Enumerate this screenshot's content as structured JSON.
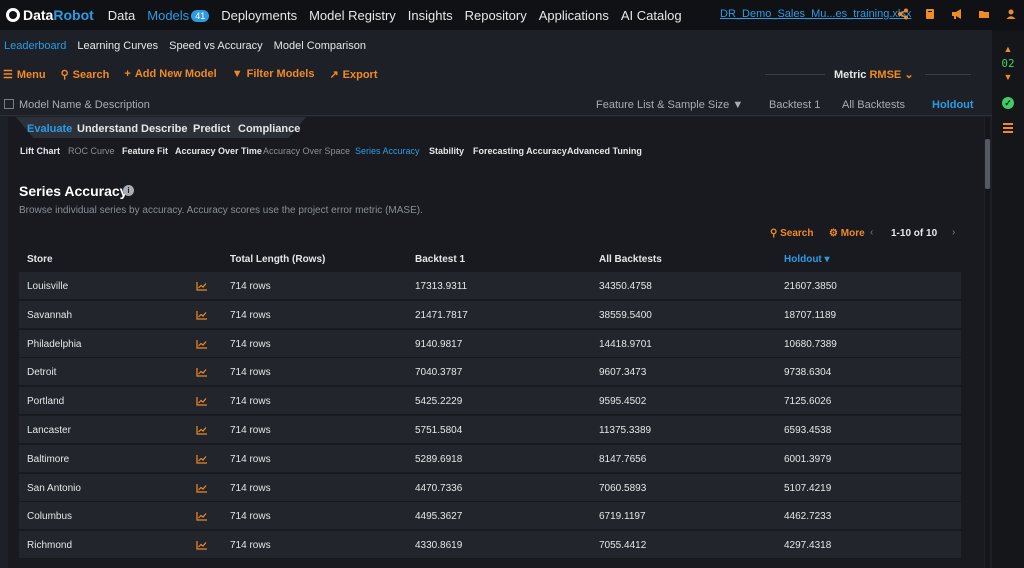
{
  "brand": {
    "part1": "Data",
    "part2": "Robot"
  },
  "nav": {
    "items": [
      {
        "label": "Data"
      },
      {
        "label": "Models",
        "badge": "41",
        "active": true
      },
      {
        "label": "Deployments"
      },
      {
        "label": "Model Registry"
      },
      {
        "label": "Insights"
      },
      {
        "label": "Repository"
      },
      {
        "label": "Applications"
      },
      {
        "label": "AI Catalog"
      }
    ],
    "filename": "DR_Demo_Sales_Mu...es_training.xlsx",
    "icons": [
      "share-icon",
      "book-icon",
      "megaphone-icon",
      "folder-icon",
      "user-icon"
    ]
  },
  "subnav": [
    "Leaderboard",
    "Learning Curves",
    "Speed vs Accuracy",
    "Model Comparison"
  ],
  "toolbar": {
    "menu": "Menu",
    "search": "Search",
    "add": "Add New Model",
    "filter": "Filter Models",
    "export": "Export",
    "metric_label": "Metric",
    "metric_value": "RMSE"
  },
  "columns": {
    "name": "Model Name & Description",
    "feature_list": "Feature List & Sample Size",
    "backtest1": "Backtest 1",
    "all_backtests": "All Backtests",
    "holdout": "Holdout"
  },
  "rail": {
    "number": "02"
  },
  "eval_tabs": [
    "Evaluate",
    "Understand",
    "Describe",
    "Predict",
    "Compliance"
  ],
  "sub_tabs": [
    "Lift Chart",
    "ROC Curve",
    "Feature Fit",
    "Accuracy Over Time",
    "Accuracy Over Space",
    "Series Accuracy",
    "Stability",
    "Forecasting Accuracy",
    "Advanced Tuning"
  ],
  "series": {
    "title": "Series Accuracy",
    "description": "Browse individual series by accuracy. Accuracy scores use the project error metric (MASE).",
    "search": "Search",
    "more": "More",
    "pagination": "1-10 of 10"
  },
  "table": {
    "headers": [
      "Store",
      "Total Length (Rows)",
      "Backtest 1",
      "All Backtests",
      "Holdout"
    ],
    "rows": [
      {
        "store": "Louisville",
        "length": "714 rows",
        "backtest1": "17313.9311",
        "all": "34350.4758",
        "holdout": "21607.3850"
      },
      {
        "store": "Savannah",
        "length": "714 rows",
        "backtest1": "21471.7817",
        "all": "38559.5400",
        "holdout": "18707.1189"
      },
      {
        "store": "Philadelphia",
        "length": "714 rows",
        "backtest1": "9140.9817",
        "all": "14418.9701",
        "holdout": "10680.7389"
      },
      {
        "store": "Detroit",
        "length": "714 rows",
        "backtest1": "7040.3787",
        "all": "9607.3473",
        "holdout": "9738.6304"
      },
      {
        "store": "Portland",
        "length": "714 rows",
        "backtest1": "5425.2229",
        "all": "9595.4502",
        "holdout": "7125.6026"
      },
      {
        "store": "Lancaster",
        "length": "714 rows",
        "backtest1": "5751.5804",
        "all": "11375.3389",
        "holdout": "6593.4538"
      },
      {
        "store": "Baltimore",
        "length": "714 rows",
        "backtest1": "5289.6918",
        "all": "8147.7656",
        "holdout": "6001.3979"
      },
      {
        "store": "San Antonio",
        "length": "714 rows",
        "backtest1": "4470.7336",
        "all": "7060.5893",
        "holdout": "5107.4219"
      },
      {
        "store": "Columbus",
        "length": "714 rows",
        "backtest1": "4495.3627",
        "all": "6719.1197",
        "holdout": "4462.7233"
      },
      {
        "store": "Richmond",
        "length": "714 rows",
        "backtest1": "4330.8619",
        "all": "7055.4412",
        "holdout": "4297.4318"
      }
    ]
  },
  "colors": {
    "accent": "#2d9be3",
    "action": "#f08a24",
    "ok": "#3ecf64"
  }
}
